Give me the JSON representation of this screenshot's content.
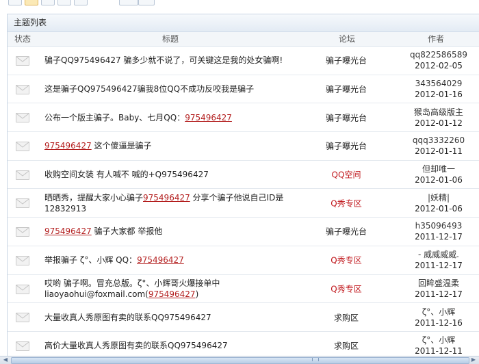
{
  "panel": {
    "title": "主题列表",
    "columns": {
      "status": "状态",
      "title": "标题",
      "forum": "论坛",
      "author": "作者"
    }
  },
  "rows": [
    {
      "parts": [
        {
          "t": "骗子QQ975496427  骗多少就不说了，可关键这是我的处女骗啊!"
        }
      ],
      "forum": "骗子曝光台",
      "forum_color": "#222222",
      "author": "qq822586589",
      "date": "2012-02-05"
    },
    {
      "parts": [
        {
          "t": "这是骗子QQ975496427骗我8位QQ不成功反咬我是骗子"
        }
      ],
      "forum": "骗子曝光台",
      "forum_color": "#222222",
      "author": "343564029",
      "date": "2012-01-16"
    },
    {
      "parts": [
        {
          "t": "公布一个版主骗子。Baby、七月QQ："
        },
        {
          "t": "975496427",
          "link": true
        }
      ],
      "forum": "骗子曝光台",
      "forum_color": "#222222",
      "author": "猴岛高级版主",
      "date": "2012-01-12"
    },
    {
      "parts": [
        {
          "t": "975496427",
          "link": true
        },
        {
          "t": "   这个傻逼是骗子"
        }
      ],
      "forum": "骗子曝光台",
      "forum_color": "#222222",
      "author": "qqq3332260",
      "date": "2012-01-11"
    },
    {
      "parts": [
        {
          "t": "收购空间女装 有人喊不 喊的+Q975496427"
        }
      ],
      "forum": "QQ空间",
      "forum_color": "#c0161b",
      "author": "但却唯一",
      "date": "2012-01-06"
    },
    {
      "parts": [
        {
          "t": "晒晒秀，提醒大家小心骗子"
        },
        {
          "t": "975496427",
          "link": true
        },
        {
          "t": " 分享个骗子他说自己ID是12832913"
        }
      ],
      "forum": "Q秀专区",
      "forum_color": "#c0161b",
      "author": "|妖精|",
      "date": "2012-01-06"
    },
    {
      "parts": [
        {
          "t": "975496427",
          "link": true
        },
        {
          "t": "  骗子大家都 举报他"
        }
      ],
      "forum": "骗子曝光台",
      "forum_color": "#222222",
      "author": "h35096493",
      "date": "2011-12-17"
    },
    {
      "parts": [
        {
          "t": "举报骗子 ζ°、小辉  QQ："
        },
        {
          "t": "975496427",
          "link": true
        }
      ],
      "forum": "Q秀专区",
      "forum_color": "#c0161b",
      "author": "- 威威威威.",
      "date": "2011-12-17"
    },
    {
      "parts": [
        {
          "t": "哎哟   骗子啊。冒充总版。ζ°、小辉哥火爆接单中  liaoyaohui@foxmail.com("
        },
        {
          "t": "975496427",
          "link": true
        },
        {
          "t": ")"
        }
      ],
      "forum": "Q秀专区",
      "forum_color": "#c0161b",
      "author": "回眸盛温柔",
      "date": "2011-12-17"
    },
    {
      "parts": [
        {
          "t": "大量收真人秀原图有卖的联系QQ975496427"
        }
      ],
      "forum": "求购区",
      "forum_color": "#222222",
      "author": "ζ°、小辉",
      "date": "2011-12-16"
    },
    {
      "parts": [
        {
          "t": "高价大量收真人秀原图有卖的联系QQ975496427"
        }
      ],
      "forum": "求购区",
      "forum_color": "#222222",
      "author": "ζ°、小辉",
      "date": "2011-12-11"
    }
  ],
  "icons": {
    "status": "envelope-icon"
  },
  "colors": {
    "link": "#b31e1e",
    "accent_forum": "#c0161b",
    "header_bg": "#e3ebf4"
  }
}
